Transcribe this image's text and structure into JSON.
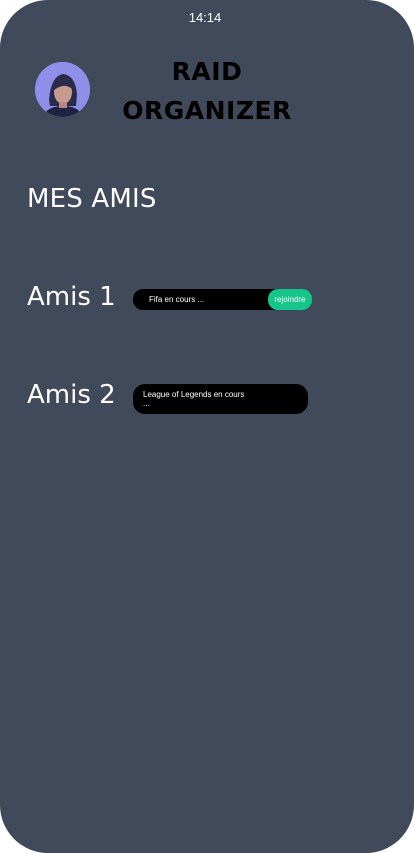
{
  "status_bar": {
    "time": "14:14"
  },
  "header": {
    "title_line1": "RAID",
    "title_line2": "ORGANIZER"
  },
  "friends_section": {
    "title": "MES AMIS",
    "friends": [
      {
        "name": "Amis 1",
        "status": "Fifa en cours ...",
        "action_label": "rejoindre"
      },
      {
        "name": "Amis 2",
        "status": "League of Legends en cours ..."
      }
    ]
  },
  "colors": {
    "background": "#404a5b",
    "join_button": "#15c589",
    "pill": "#000000"
  }
}
